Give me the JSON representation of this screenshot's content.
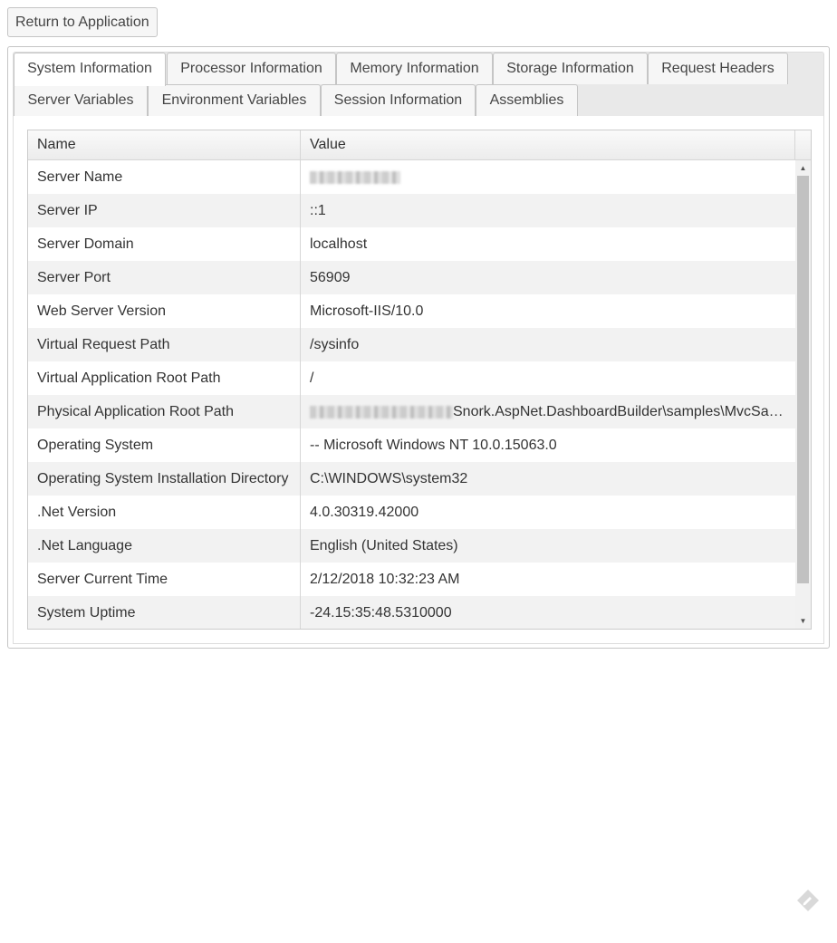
{
  "return_button": {
    "label": "Return to Application"
  },
  "tabs": [
    {
      "label": "System Information",
      "active": true
    },
    {
      "label": "Processor Information",
      "active": false
    },
    {
      "label": "Memory Information",
      "active": false
    },
    {
      "label": "Storage Information",
      "active": false
    },
    {
      "label": "Request Headers",
      "active": false
    },
    {
      "label": "Server Variables",
      "active": false
    },
    {
      "label": "Environment Variables",
      "active": false
    },
    {
      "label": "Session Information",
      "active": false
    },
    {
      "label": "Assemblies",
      "active": false
    }
  ],
  "grid": {
    "columns": {
      "name": "Name",
      "value": "Value"
    },
    "rows": [
      {
        "name": "Server Name",
        "value": ""
      },
      {
        "name": "Server IP",
        "value": "::1"
      },
      {
        "name": "Server Domain",
        "value": "localhost"
      },
      {
        "name": "Server Port",
        "value": "56909"
      },
      {
        "name": "Web Server Version",
        "value": "Microsoft-IIS/10.0"
      },
      {
        "name": "Virtual Request Path",
        "value": "/sysinfo"
      },
      {
        "name": "Virtual Application Root Path",
        "value": "/"
      },
      {
        "name": "Physical Application Root Path",
        "value": "Snork.AspNet.DashboardBuilder\\samples\\MvcSa…"
      },
      {
        "name": "Operating System",
        "value": "-- Microsoft Windows NT 10.0.15063.0"
      },
      {
        "name": "Operating System Installation Directory",
        "value": "C:\\WINDOWS\\system32"
      },
      {
        "name": ".Net Version",
        "value": "4.0.30319.42000"
      },
      {
        "name": ".Net Language",
        "value": "English (United States)"
      },
      {
        "name": "Server Current Time",
        "value": "2/12/2018 10:32:23 AM"
      },
      {
        "name": "System Uptime",
        "value": "-24.15:35:48.5310000"
      }
    ]
  },
  "icons": {
    "scroll_up": "scroll-up-arrow",
    "scroll_down": "scroll-down-arrow",
    "corner": "edit-tag-icon"
  }
}
